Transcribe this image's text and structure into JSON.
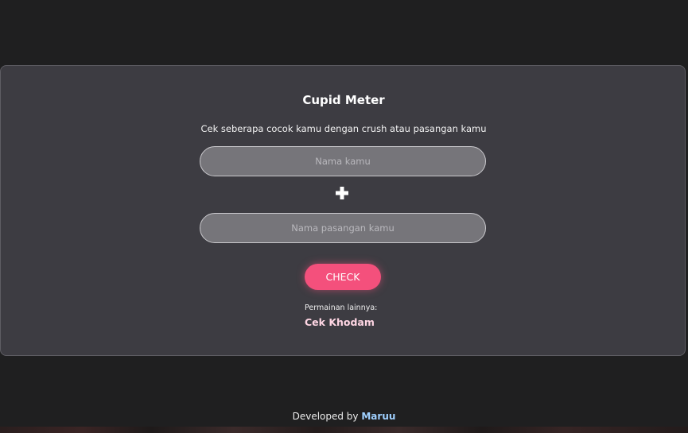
{
  "card": {
    "title": "Cupid Meter",
    "subtitle": "Cek seberapa cocok kamu dengan crush atau pasangan kamu",
    "name_input": {
      "placeholder": "Nama kamu",
      "value": ""
    },
    "partner_input": {
      "placeholder": "Nama pasangan kamu",
      "value": ""
    },
    "plus_icon": "plus-icon",
    "check_label": "CHECK",
    "more_games_label": "Permainan lainnya:",
    "more_games_link": "Cek Khodam"
  },
  "footer": {
    "prefix": "Developed by",
    "developer": "Maruu"
  },
  "colors": {
    "background": "#1f1f20",
    "card": "#3d3c42",
    "input": "#76757a",
    "accent": "#f4507c",
    "link_pink": "#ffd6e4",
    "link_blue": "#9fd0ff"
  }
}
